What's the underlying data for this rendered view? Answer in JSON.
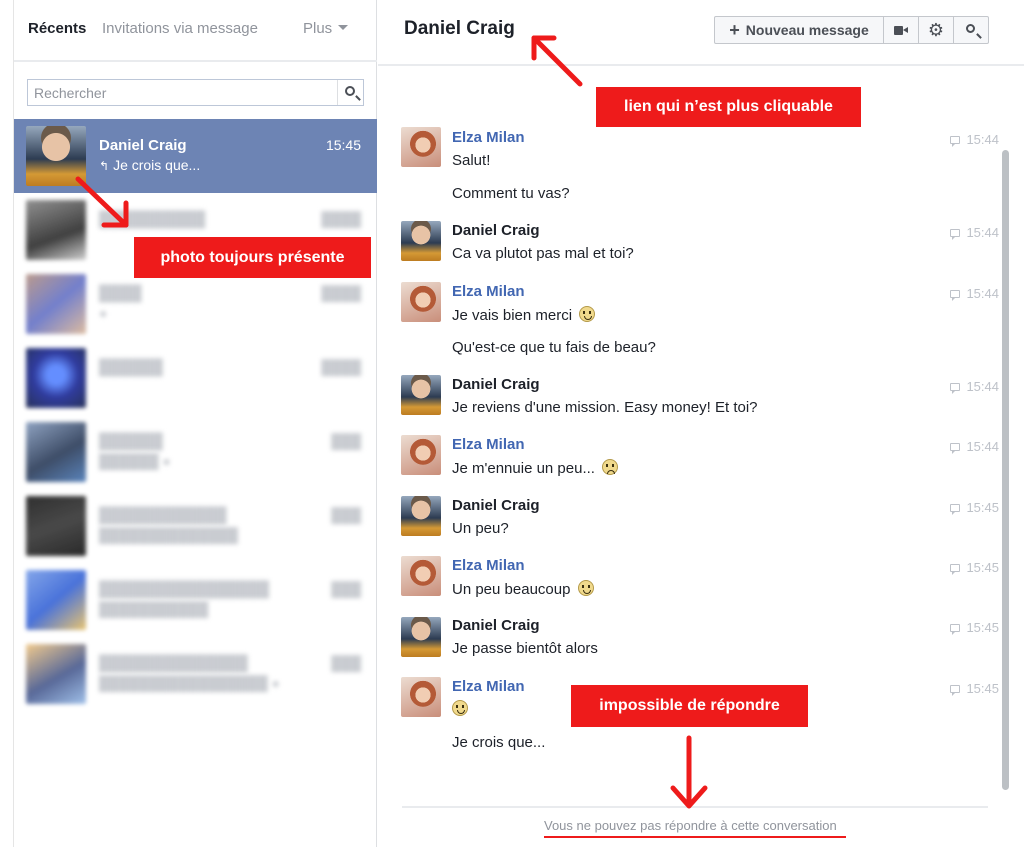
{
  "left_panel": {
    "tabs": {
      "recents": "Récents",
      "invitations": "Invitations via message",
      "more": "Plus"
    },
    "search_placeholder": "Rechercher",
    "conversations": [
      {
        "name": "Daniel Craig",
        "time": "15:45",
        "snippet": "Je crois que..."
      }
    ]
  },
  "header": {
    "conversation_title": "Daniel Craig",
    "new_message_label": "Nouveau message",
    "icons": [
      "plus-icon",
      "video-camera-icon",
      "gear-icon",
      "search-icon"
    ]
  },
  "messages": [
    {
      "sender": "Elza Milan",
      "time": "15:44",
      "lines": [
        "Salut!",
        "Comment tu vas?"
      ]
    },
    {
      "sender": "Daniel Craig",
      "time": "15:44",
      "lines": [
        "Ca va plutot pas mal et toi?"
      ]
    },
    {
      "sender": "Elza Milan",
      "time": "15:44",
      "lines": [
        "Je vais bien merci",
        "Qu'est-ce que tu fais de beau?"
      ]
    },
    {
      "sender": "Daniel Craig",
      "time": "15:44",
      "lines": [
        "Je reviens d'une mission. Easy money! Et toi?"
      ]
    },
    {
      "sender": "Elza Milan",
      "time": "15:44",
      "lines": [
        "Je m'ennuie un peu..."
      ]
    },
    {
      "sender": "Daniel Craig",
      "time": "15:45",
      "lines": [
        "Un peu?"
      ]
    },
    {
      "sender": "Elza Milan",
      "time": "15:45",
      "lines": [
        "Un peu beaucoup"
      ]
    },
    {
      "sender": "Daniel Craig",
      "time": "15:45",
      "lines": [
        "Je passe bientôt alors"
      ]
    },
    {
      "sender": "Elza Milan",
      "time": "15:45",
      "lines": [
        "",
        "Je crois que..."
      ]
    }
  ],
  "footer": {
    "cannot_reply": "Vous ne pouvez pas répondre à cette conversation"
  },
  "annotations": {
    "link_not_clickable": "lien qui n’est plus cliquable",
    "photo_still_present": "photo toujours présente",
    "cannot_reply": "impossible de répondre"
  },
  "colors": {
    "selected_row": "#6d84b4",
    "link_blue": "#4267b2",
    "annotation_red": "#ee1b1b"
  }
}
